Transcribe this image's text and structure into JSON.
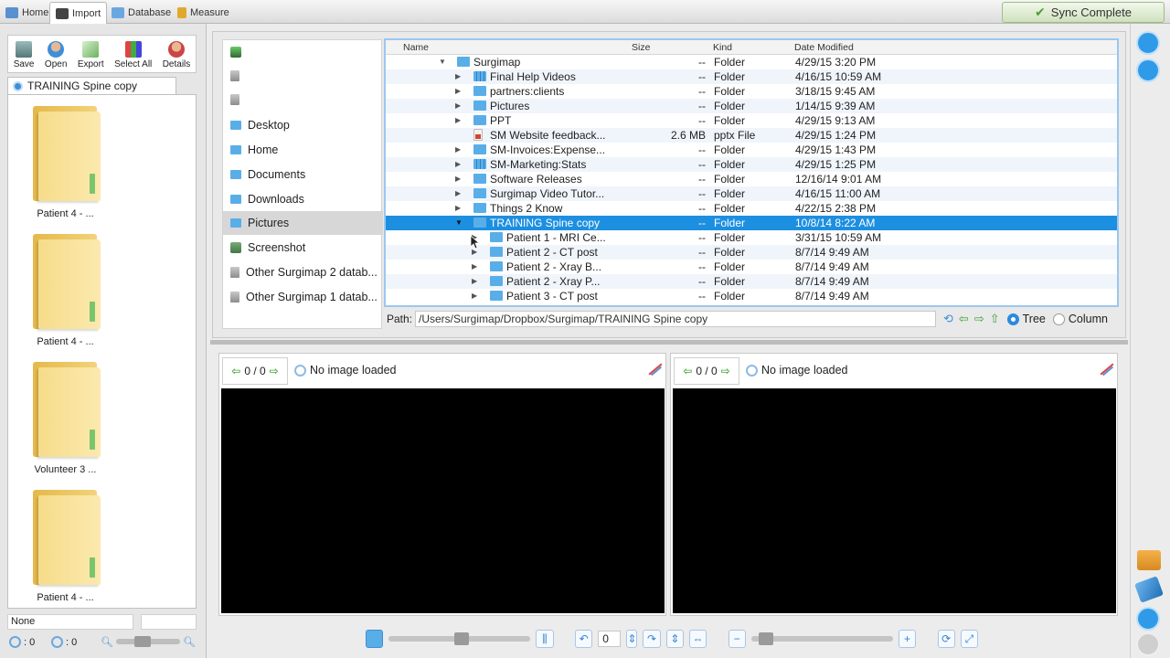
{
  "topbar": {
    "tabs": [
      {
        "label": "Home",
        "icon": "home-icon"
      },
      {
        "label": "Import",
        "icon": "import-icon",
        "active": true
      },
      {
        "label": "Database",
        "icon": "database-icon"
      },
      {
        "label": "Measure",
        "icon": "measure-icon"
      }
    ],
    "sync_label": "Sync Complete"
  },
  "left": {
    "toolbar": [
      {
        "label": "Save",
        "icon": "save-icon"
      },
      {
        "label": "Open",
        "icon": "open-icon"
      },
      {
        "label": "Export",
        "icon": "export-icon"
      },
      {
        "label": "Select All",
        "icon": "select-all-icon"
      },
      {
        "label": "Details",
        "icon": "details-icon"
      }
    ],
    "tab_label": "TRAINING Spine copy",
    "thumbnails": [
      {
        "label": "Patient 4 - ..."
      },
      {
        "label": "Patient 4 - ..."
      },
      {
        "label": "Volunteer 3 ..."
      },
      {
        "label": "Patient 4 - ..."
      }
    ],
    "filter_value": "None",
    "status_a": ": 0",
    "status_b": ": 0"
  },
  "places": {
    "items": [
      {
        "label": "",
        "icon": "device-icon"
      },
      {
        "label": "",
        "icon": "drive-icon"
      },
      {
        "label": "",
        "icon": "drive-icon"
      },
      {
        "label": "Desktop",
        "icon": "folder-icon"
      },
      {
        "label": "Home",
        "icon": "folder-icon"
      },
      {
        "label": "Documents",
        "icon": "folder-icon"
      },
      {
        "label": "Downloads",
        "icon": "folder-icon"
      },
      {
        "label": "Pictures",
        "icon": "folder-icon",
        "selected": true
      },
      {
        "label": "Screenshot",
        "icon": "folder-icon"
      },
      {
        "label": "Other Surgimap 2 datab...",
        "icon": "database-icon"
      },
      {
        "label": "Other Surgimap 1 datab...",
        "icon": "database-icon"
      }
    ]
  },
  "filelist": {
    "columns": {
      "name": "Name",
      "size": "Size",
      "kind": "Kind",
      "date": "Date Modified"
    },
    "rows": [
      {
        "name": "Surgimap",
        "size": "--",
        "kind": "Folder",
        "date": "4/29/15 3:20 PM",
        "indent": 0,
        "expanded": true,
        "icon": "folder"
      },
      {
        "name": "Final Help Videos",
        "size": "--",
        "kind": "Folder",
        "date": "4/16/15 10:59 AM",
        "indent": 1,
        "icon": "grid"
      },
      {
        "name": "partners:clients",
        "size": "--",
        "kind": "Folder",
        "date": "3/18/15 9:45 AM",
        "indent": 1,
        "icon": "folder"
      },
      {
        "name": "Pictures",
        "size": "--",
        "kind": "Folder",
        "date": "1/14/15 9:39 AM",
        "indent": 1,
        "icon": "folder"
      },
      {
        "name": "PPT",
        "size": "--",
        "kind": "Folder",
        "date": "4/29/15 9:13 AM",
        "indent": 1,
        "icon": "folder"
      },
      {
        "name": "SM Website feedback...",
        "size": "2.6 MB",
        "kind": "pptx File",
        "date": "4/29/15 1:24 PM",
        "indent": 1,
        "icon": "doc",
        "leaf": true
      },
      {
        "name": "SM-Invoices:Expense...",
        "size": "--",
        "kind": "Folder",
        "date": "4/29/15 1:43 PM",
        "indent": 1,
        "icon": "folder"
      },
      {
        "name": "SM-Marketing:Stats",
        "size": "--",
        "kind": "Folder",
        "date": "4/29/15 1:25 PM",
        "indent": 1,
        "icon": "grid"
      },
      {
        "name": "Software Releases",
        "size": "--",
        "kind": "Folder",
        "date": "12/16/14 9:01 AM",
        "indent": 1,
        "icon": "folder"
      },
      {
        "name": "Surgimap Video Tutor...",
        "size": "--",
        "kind": "Folder",
        "date": "4/16/15 11:00 AM",
        "indent": 1,
        "icon": "folder"
      },
      {
        "name": "Things 2 Know",
        "size": "--",
        "kind": "Folder",
        "date": "4/22/15 2:38 PM",
        "indent": 1,
        "icon": "folder"
      },
      {
        "name": "TRAINING Spine copy",
        "size": "--",
        "kind": "Folder",
        "date": "10/8/14 8:22 AM",
        "indent": 1,
        "icon": "folder",
        "expanded": true,
        "selected": true
      },
      {
        "name": "Patient 1 - MRI Ce...",
        "size": "--",
        "kind": "Folder",
        "date": "3/31/15 10:59 AM",
        "indent": 2,
        "icon": "folder"
      },
      {
        "name": "Patient 2 - CT post",
        "size": "--",
        "kind": "Folder",
        "date": "8/7/14 9:49 AM",
        "indent": 2,
        "icon": "folder"
      },
      {
        "name": "Patient 2 - Xray B...",
        "size": "--",
        "kind": "Folder",
        "date": "8/7/14 9:49 AM",
        "indent": 2,
        "icon": "folder"
      },
      {
        "name": "Patient 2 - Xray P...",
        "size": "--",
        "kind": "Folder",
        "date": "8/7/14 9:49 AM",
        "indent": 2,
        "icon": "folder"
      },
      {
        "name": "Patient 3 - CT post",
        "size": "--",
        "kind": "Folder",
        "date": "8/7/14 9:49 AM",
        "indent": 2,
        "icon": "folder"
      }
    ]
  },
  "path": {
    "label": "Path:",
    "value": "/Users/Surgimap/Dropbox/Surgimap/TRAINING Spine copy",
    "view_tree": "Tree",
    "view_column": "Column"
  },
  "viewers": [
    {
      "counter": "0 / 0",
      "message": "No image loaded"
    },
    {
      "counter": "0 / 0",
      "message": "No image loaded"
    }
  ],
  "bottombar": {
    "frame_value": "0"
  },
  "colors": {
    "accent": "#1d8fe0",
    "folder": "#5aaee8",
    "sync_green": "#4da12e"
  }
}
